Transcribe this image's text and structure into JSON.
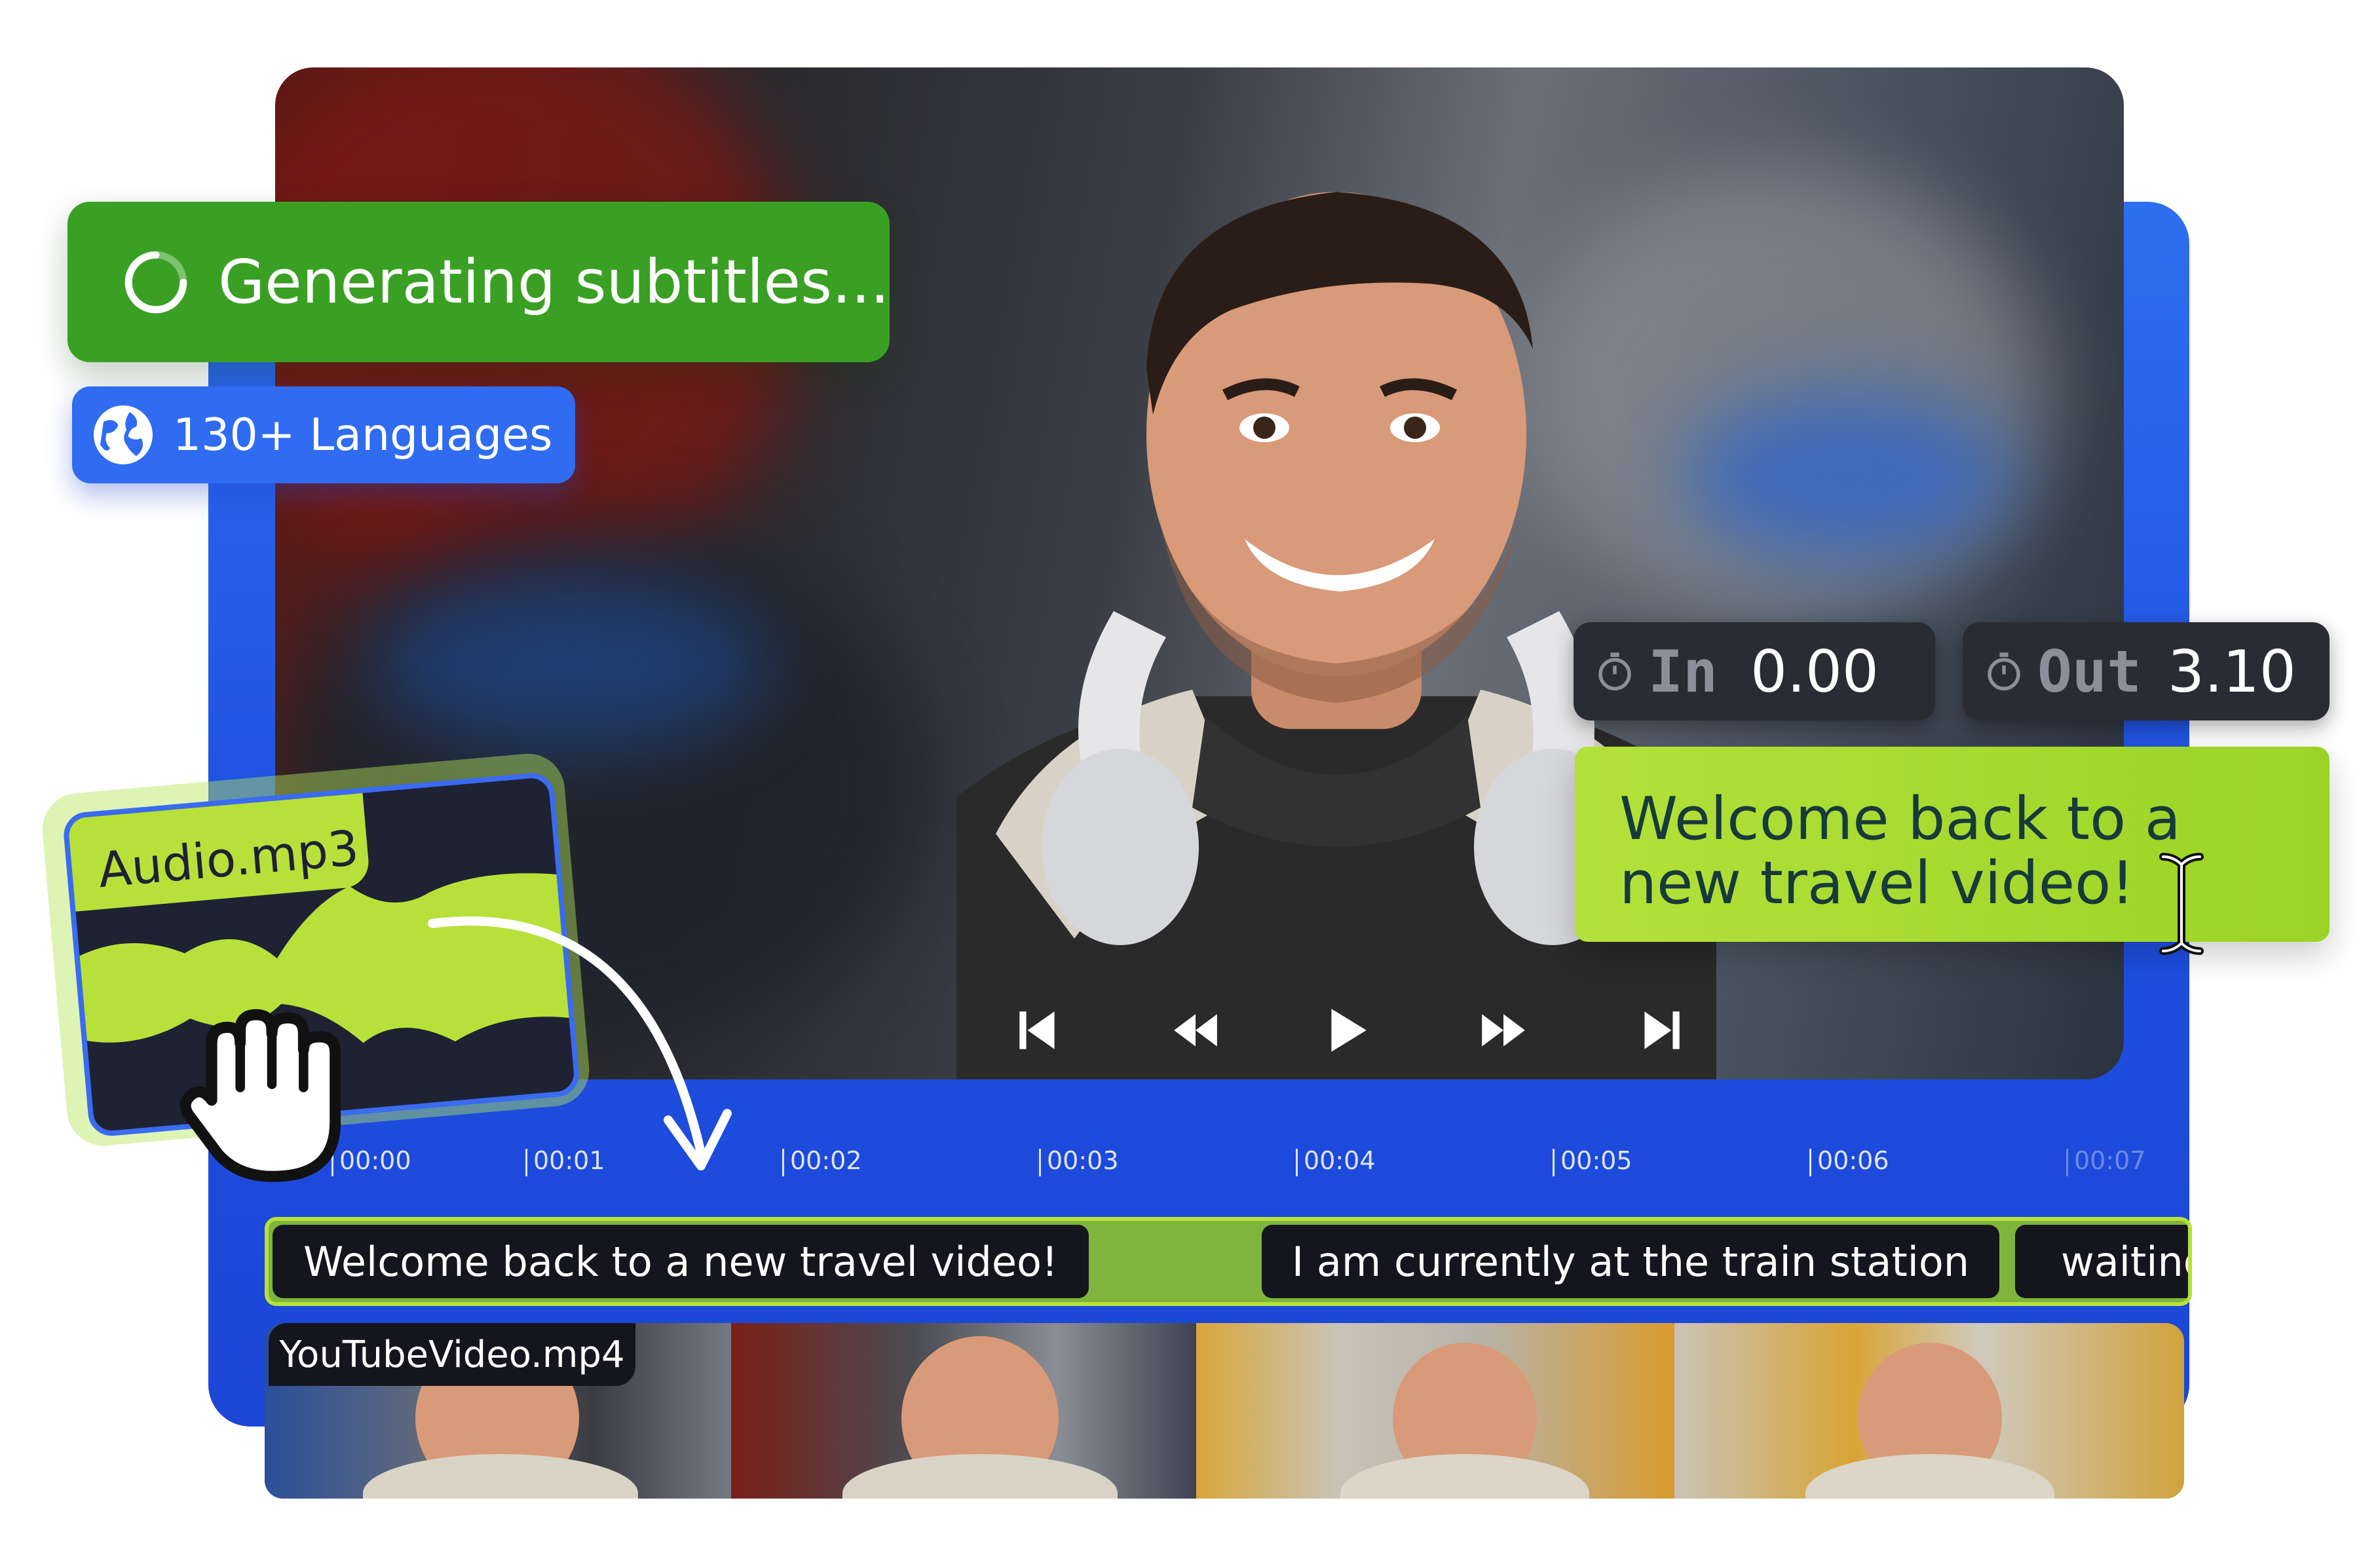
{
  "status": {
    "generating_label": "Generating subtitles..."
  },
  "languages": {
    "label": "130+ Languages"
  },
  "timing": {
    "in_label": "In",
    "in_value": "0.00",
    "out_label": "Out",
    "out_value": "3.10"
  },
  "subtitle_editor": {
    "text": "Welcome back to a new travel video!"
  },
  "audio_clip": {
    "name": "Audio.mp3"
  },
  "player_controls": [
    "skip-to-start-icon",
    "rewind-icon",
    "play-icon",
    "fast-forward-icon",
    "skip-to-end-icon"
  ],
  "timeline": {
    "ticks": [
      "00:00",
      "00:01",
      "00:02",
      "00:03",
      "00:04",
      "00:05",
      "00:06",
      "00:07"
    ],
    "subtitle_segments": [
      "Welcome back to a new travel video!",
      "I am currently at the train station",
      "waiting"
    ],
    "video_clip_name": "YouTubeVideo.mp4"
  },
  "colors": {
    "brand_blue": "#2f6cf1",
    "accent_green": "#b7e13a",
    "status_green": "#3aa023",
    "dark": "#15161d"
  }
}
